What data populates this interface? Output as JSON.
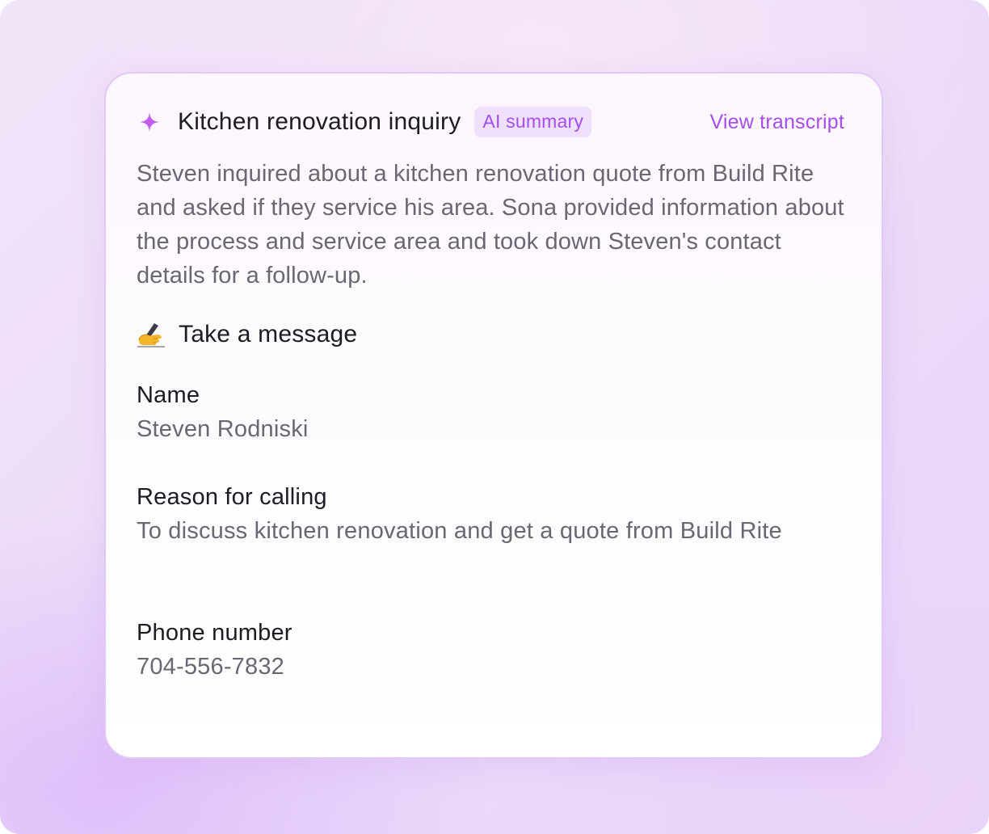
{
  "card": {
    "title": "Kitchen renovation inquiry",
    "badge": "AI summary",
    "transcript_link": "View transcript",
    "summary": "Steven inquired about a kitchen renovation quote from Build Rite and asked if they service his area. Sona provided information about the process and service area and took down Steven's contact details for a follow-up."
  },
  "section": {
    "icon": "writing-hand-icon",
    "title": "Take a message"
  },
  "fields": [
    {
      "label": "Name",
      "value": "Steven Rodniski"
    },
    {
      "label": "Reason for calling",
      "value": "To discuss kitchen renovation and get a quote from Build Rite"
    },
    {
      "label": "Phone number",
      "value": "704-556-7832"
    }
  ],
  "colors": {
    "accent": "#a54df0",
    "badge_bg": "#efe1fb",
    "card_border": "#e3c8f7",
    "text_primary": "#1f1b24",
    "text_secondary": "#6b6673"
  }
}
